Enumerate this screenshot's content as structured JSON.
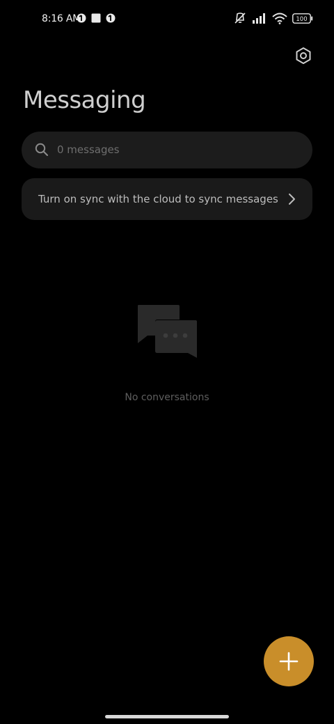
{
  "status_bar": {
    "time": "8:16 AM",
    "battery": "100",
    "left_icons": [
      "app-notification-icon",
      "square-notification-icon",
      "app-notification-icon"
    ],
    "right_icons": [
      "muted-vibrate-icon",
      "signal-icon",
      "wifi-icon",
      "battery-icon"
    ]
  },
  "header": {
    "title": "Messaging",
    "settings_icon": "settings-icon"
  },
  "search": {
    "placeholder": "0 messages",
    "icon": "search-icon"
  },
  "sync_banner": {
    "text": "Turn on sync with the cloud to sync messages",
    "icon": "chevron-right-icon"
  },
  "empty_state": {
    "icon": "conversations-icon",
    "text": "No conversations"
  },
  "fab": {
    "icon": "plus-icon",
    "color": "#c98e2a"
  }
}
